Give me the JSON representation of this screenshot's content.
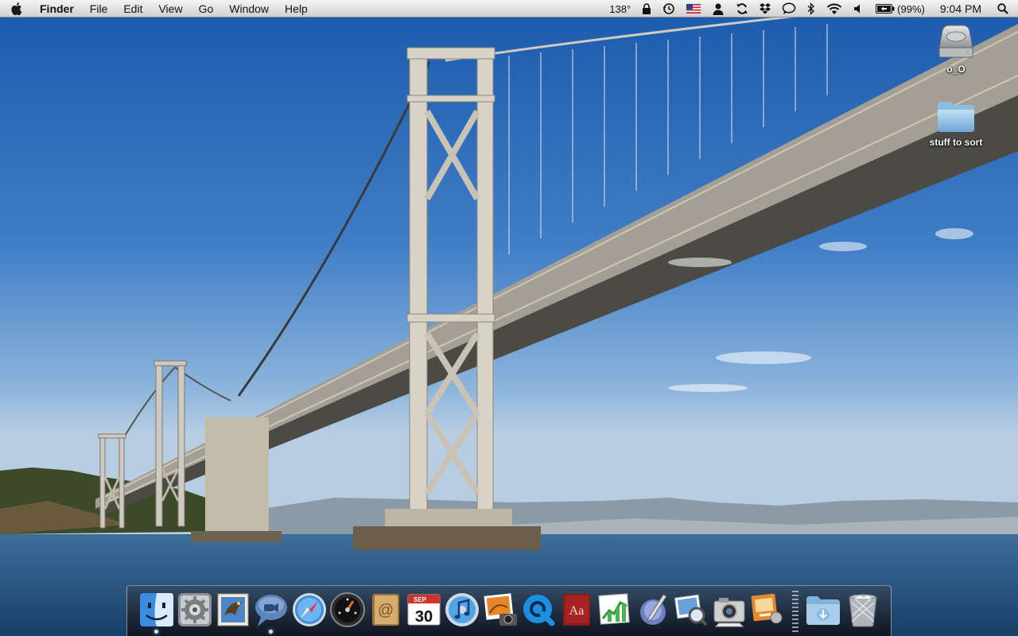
{
  "menubar": {
    "app_name": "Finder",
    "menus": [
      "File",
      "Edit",
      "View",
      "Go",
      "Window",
      "Help"
    ],
    "status": {
      "temperature": "138°",
      "battery_percent": "(99%)",
      "clock": "9:04 PM"
    },
    "icons": [
      "apple-menu-icon",
      "lock-icon",
      "time-machine-icon",
      "us-flag-icon",
      "user-icon",
      "sync-icon",
      "dropbox-icon",
      "chat-icon",
      "bluetooth-icon",
      "wifi-icon",
      "volume-icon",
      "battery-icon",
      "spotlight-icon"
    ]
  },
  "desktop": {
    "icons": [
      {
        "label": "o_O",
        "type": "hard-drive-icon"
      },
      {
        "label": "stuff to sort",
        "type": "folder-icon"
      }
    ]
  },
  "dock": {
    "apps": [
      {
        "name": "finder-icon",
        "running": true
      },
      {
        "name": "system-preferences-icon",
        "running": false
      },
      {
        "name": "mail-icon",
        "running": false
      },
      {
        "name": "ichat-icon",
        "running": true
      },
      {
        "name": "safari-icon",
        "running": false
      },
      {
        "name": "dashboard-icon",
        "running": false
      },
      {
        "name": "address-book-icon",
        "running": false
      },
      {
        "name": "ical-icon",
        "running": false
      },
      {
        "name": "itunes-icon",
        "running": false
      },
      {
        "name": "iphoto-icon",
        "running": false
      },
      {
        "name": "quicktime-icon",
        "running": false
      },
      {
        "name": "dictionary-icon",
        "running": false
      },
      {
        "name": "activity-chart-icon",
        "running": false
      },
      {
        "name": "script-editor-icon",
        "running": false
      },
      {
        "name": "preview-icon",
        "running": false
      },
      {
        "name": "image-capture-icon",
        "running": false
      },
      {
        "name": "keynote-icon",
        "running": false
      },
      {
        "name": "downloads-stack-icon",
        "running": false
      },
      {
        "name": "trash-icon",
        "running": false
      }
    ],
    "ical_month": "SEP",
    "ical_day": "30",
    "dictionary_label": "Aa"
  },
  "colors": {
    "menubar_bg": "#e3e3e3",
    "sky_top": "#1f5fae",
    "water": "#1f4d7c",
    "dock_indicator": "#cfe6ff"
  }
}
